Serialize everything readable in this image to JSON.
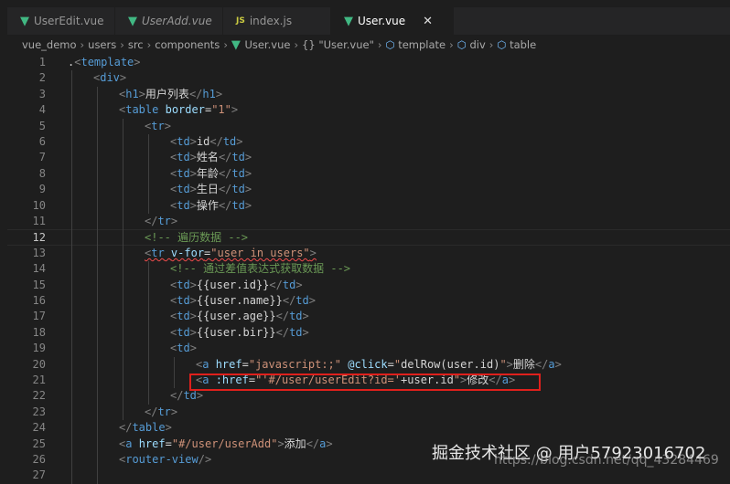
{
  "tabs": [
    {
      "label": "UserEdit.vue",
      "icon": "vue-icon",
      "active": false,
      "italic": false
    },
    {
      "label": "UserAdd.vue",
      "icon": "vue-icon",
      "active": false,
      "italic": true
    },
    {
      "label": "index.js",
      "icon": "js-icon",
      "active": false,
      "italic": false
    },
    {
      "label": "User.vue",
      "icon": "vue-icon",
      "active": true,
      "italic": false
    }
  ],
  "close_symbol": "✕",
  "breadcrumb": [
    "vue_demo",
    "users",
    "src",
    "components",
    "User.vue",
    "{} \"User.vue\"",
    "template",
    "div",
    "table"
  ],
  "current_line": 12,
  "lines": [
    [
      [
        "x",
        "."
      ],
      [
        "p",
        "<"
      ],
      [
        "t",
        "template"
      ],
      [
        "p",
        ">"
      ]
    ],
    [
      [
        "p",
        "<"
      ],
      [
        "t",
        "div"
      ],
      [
        "p",
        ">"
      ]
    ],
    [
      [
        "p",
        "<"
      ],
      [
        "t",
        "h1"
      ],
      [
        "p",
        ">"
      ],
      [
        "x",
        "用户列表"
      ],
      [
        "p",
        "</"
      ],
      [
        "t",
        "h1"
      ],
      [
        "p",
        ">"
      ]
    ],
    [
      [
        "p",
        "<"
      ],
      [
        "t",
        "table"
      ],
      [
        "x",
        " "
      ],
      [
        "a",
        "border"
      ],
      [
        "x",
        "="
      ],
      [
        "s",
        "\"1\""
      ],
      [
        "p",
        ">"
      ]
    ],
    [
      [
        "p",
        "<"
      ],
      [
        "t",
        "tr"
      ],
      [
        "p",
        ">"
      ]
    ],
    [
      [
        "p",
        "<"
      ],
      [
        "t",
        "td"
      ],
      [
        "p",
        ">"
      ],
      [
        "x",
        "id"
      ],
      [
        "p",
        "</"
      ],
      [
        "t",
        "td"
      ],
      [
        "p",
        ">"
      ]
    ],
    [
      [
        "p",
        "<"
      ],
      [
        "t",
        "td"
      ],
      [
        "p",
        ">"
      ],
      [
        "x",
        "姓名"
      ],
      [
        "p",
        "</"
      ],
      [
        "t",
        "td"
      ],
      [
        "p",
        ">"
      ]
    ],
    [
      [
        "p",
        "<"
      ],
      [
        "t",
        "td"
      ],
      [
        "p",
        ">"
      ],
      [
        "x",
        "年龄"
      ],
      [
        "p",
        "</"
      ],
      [
        "t",
        "td"
      ],
      [
        "p",
        ">"
      ]
    ],
    [
      [
        "p",
        "<"
      ],
      [
        "t",
        "td"
      ],
      [
        "p",
        ">"
      ],
      [
        "x",
        "生日"
      ],
      [
        "p",
        "</"
      ],
      [
        "t",
        "td"
      ],
      [
        "p",
        ">"
      ]
    ],
    [
      [
        "p",
        "<"
      ],
      [
        "t",
        "td"
      ],
      [
        "p",
        ">"
      ],
      [
        "x",
        "操作"
      ],
      [
        "p",
        "</"
      ],
      [
        "t",
        "td"
      ],
      [
        "p",
        ">"
      ]
    ],
    [
      [
        "p",
        "</"
      ],
      [
        "t",
        "tr"
      ],
      [
        "p",
        ">"
      ]
    ],
    [
      [
        "c",
        "<!-- 遍历数据 -->"
      ]
    ],
    [
      [
        "p",
        "<"
      ],
      [
        "t",
        "tr"
      ],
      [
        "x",
        " "
      ],
      [
        "a",
        "v-for"
      ],
      [
        "x",
        "="
      ],
      [
        "s",
        "\"user in users\""
      ],
      [
        "p",
        ">"
      ]
    ],
    [
      [
        "c",
        "<!-- 通过差值表达式获取数据 -->"
      ]
    ],
    [
      [
        "p",
        "<"
      ],
      [
        "t",
        "td"
      ],
      [
        "p",
        ">"
      ],
      [
        "x",
        "{{user.id}}"
      ],
      [
        "p",
        "</"
      ],
      [
        "t",
        "td"
      ],
      [
        "p",
        ">"
      ]
    ],
    [
      [
        "p",
        "<"
      ],
      [
        "t",
        "td"
      ],
      [
        "p",
        ">"
      ],
      [
        "x",
        "{{user.name}}"
      ],
      [
        "p",
        "</"
      ],
      [
        "t",
        "td"
      ],
      [
        "p",
        ">"
      ]
    ],
    [
      [
        "p",
        "<"
      ],
      [
        "t",
        "td"
      ],
      [
        "p",
        ">"
      ],
      [
        "x",
        "{{user.age}}"
      ],
      [
        "p",
        "</"
      ],
      [
        "t",
        "td"
      ],
      [
        "p",
        ">"
      ]
    ],
    [
      [
        "p",
        "<"
      ],
      [
        "t",
        "td"
      ],
      [
        "p",
        ">"
      ],
      [
        "x",
        "{{user.bir}}"
      ],
      [
        "p",
        "</"
      ],
      [
        "t",
        "td"
      ],
      [
        "p",
        ">"
      ]
    ],
    [
      [
        "p",
        "<"
      ],
      [
        "t",
        "td"
      ],
      [
        "p",
        ">"
      ]
    ],
    [
      [
        "p",
        "<"
      ],
      [
        "t",
        "a"
      ],
      [
        "x",
        " "
      ],
      [
        "a",
        "href"
      ],
      [
        "x",
        "="
      ],
      [
        "s",
        "\"javascript:;\""
      ],
      [
        "x",
        " "
      ],
      [
        "a",
        "@click"
      ],
      [
        "x",
        "="
      ],
      [
        "s",
        "\""
      ],
      [
        "x",
        "delRow(user.id)"
      ],
      [
        "s",
        "\""
      ],
      [
        "p",
        ">"
      ],
      [
        "x",
        "删除"
      ],
      [
        "p",
        "</"
      ],
      [
        "t",
        "a"
      ],
      [
        "p",
        ">"
      ]
    ],
    [
      [
        "p",
        "<"
      ],
      [
        "t",
        "a"
      ],
      [
        "x",
        " "
      ],
      [
        "a",
        ":href"
      ],
      [
        "x",
        "="
      ],
      [
        "s",
        "\"'#/user/userEdit?id='"
      ],
      [
        "x",
        "+user.id"
      ],
      [
        "s",
        "\""
      ],
      [
        "p",
        ">"
      ],
      [
        "x",
        "修改"
      ],
      [
        "p",
        "</"
      ],
      [
        "t",
        "a"
      ],
      [
        "p",
        ">"
      ]
    ],
    [
      [
        "p",
        "</"
      ],
      [
        "t",
        "td"
      ],
      [
        "p",
        ">"
      ]
    ],
    [
      [
        "p",
        "</"
      ],
      [
        "t",
        "tr"
      ],
      [
        "p",
        ">"
      ]
    ],
    [
      [
        "p",
        "</"
      ],
      [
        "t",
        "table"
      ],
      [
        "p",
        ">"
      ]
    ],
    [
      [
        "p",
        "<"
      ],
      [
        "t",
        "a"
      ],
      [
        "x",
        " "
      ],
      [
        "a",
        "href"
      ],
      [
        "x",
        "="
      ],
      [
        "s",
        "\"#/user/userAdd\""
      ],
      [
        "p",
        ">"
      ],
      [
        "x",
        "添加"
      ],
      [
        "p",
        "</"
      ],
      [
        "t",
        "a"
      ],
      [
        "p",
        ">"
      ]
    ],
    [
      [
        "p",
        "<"
      ],
      [
        "t",
        "router-view"
      ],
      [
        "p",
        "/>"
      ]
    ],
    []
  ],
  "indents": [
    0,
    1,
    2,
    2,
    3,
    4,
    4,
    4,
    4,
    4,
    3,
    3,
    3,
    4,
    4,
    4,
    4,
    4,
    4,
    5,
    5,
    4,
    3,
    2,
    2,
    2,
    2
  ],
  "watermark": "掘金技术社区 @ 用户57923016702",
  "watermark2": "https://blog.csdn.net/qq_43284469"
}
